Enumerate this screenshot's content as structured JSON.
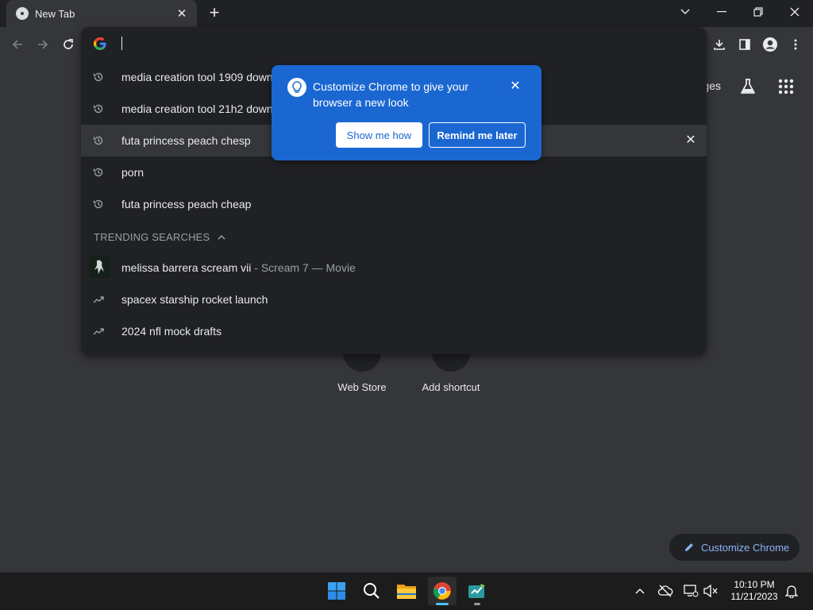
{
  "tab": {
    "title": "New Tab",
    "close": "✕",
    "new_tab": "+"
  },
  "window_controls": {
    "chevron": "⌄",
    "minimize": "—",
    "restore": "❐",
    "close": "✕"
  },
  "omnibox": {
    "value": "",
    "suggestions": [
      {
        "icon": "history-icon",
        "text": "media creation tool 1909 down"
      },
      {
        "icon": "history-icon",
        "text": "media creation tool 21h2 down"
      },
      {
        "icon": "history-icon",
        "text": "futa princess peach chesp",
        "selected": true
      },
      {
        "icon": "history-icon",
        "text": "porn"
      },
      {
        "icon": "history-icon",
        "text": "futa princess peach cheap"
      }
    ],
    "trending_header": "TRENDING SEARCHES",
    "trending": [
      {
        "icon": "thumbnail",
        "text": "melissa barrera scream vii",
        "sub": " - Scream 7 — Movie"
      },
      {
        "icon": "trending-icon",
        "text": "spacex starship rocket launch"
      },
      {
        "icon": "trending-icon",
        "text": "2024 nfl mock drafts"
      }
    ],
    "remove_icon": "✕"
  },
  "popup": {
    "text": "Customize Chrome to give your browser a new look",
    "close": "✕",
    "primary": "Show me how",
    "secondary": "Remind me later"
  },
  "ntp": {
    "images_partial": "ges",
    "shortcuts": [
      {
        "label": "Web Store"
      },
      {
        "label": "Add shortcut",
        "icon": "+"
      }
    ],
    "customize": "Customize Chrome"
  },
  "taskbar": {
    "time": "10:10 PM",
    "date": "11/21/2023"
  },
  "colors": {
    "accent": "#1a67d2",
    "link": "#8ab4f8",
    "background": "#35363a",
    "omnibox": "#202124"
  }
}
